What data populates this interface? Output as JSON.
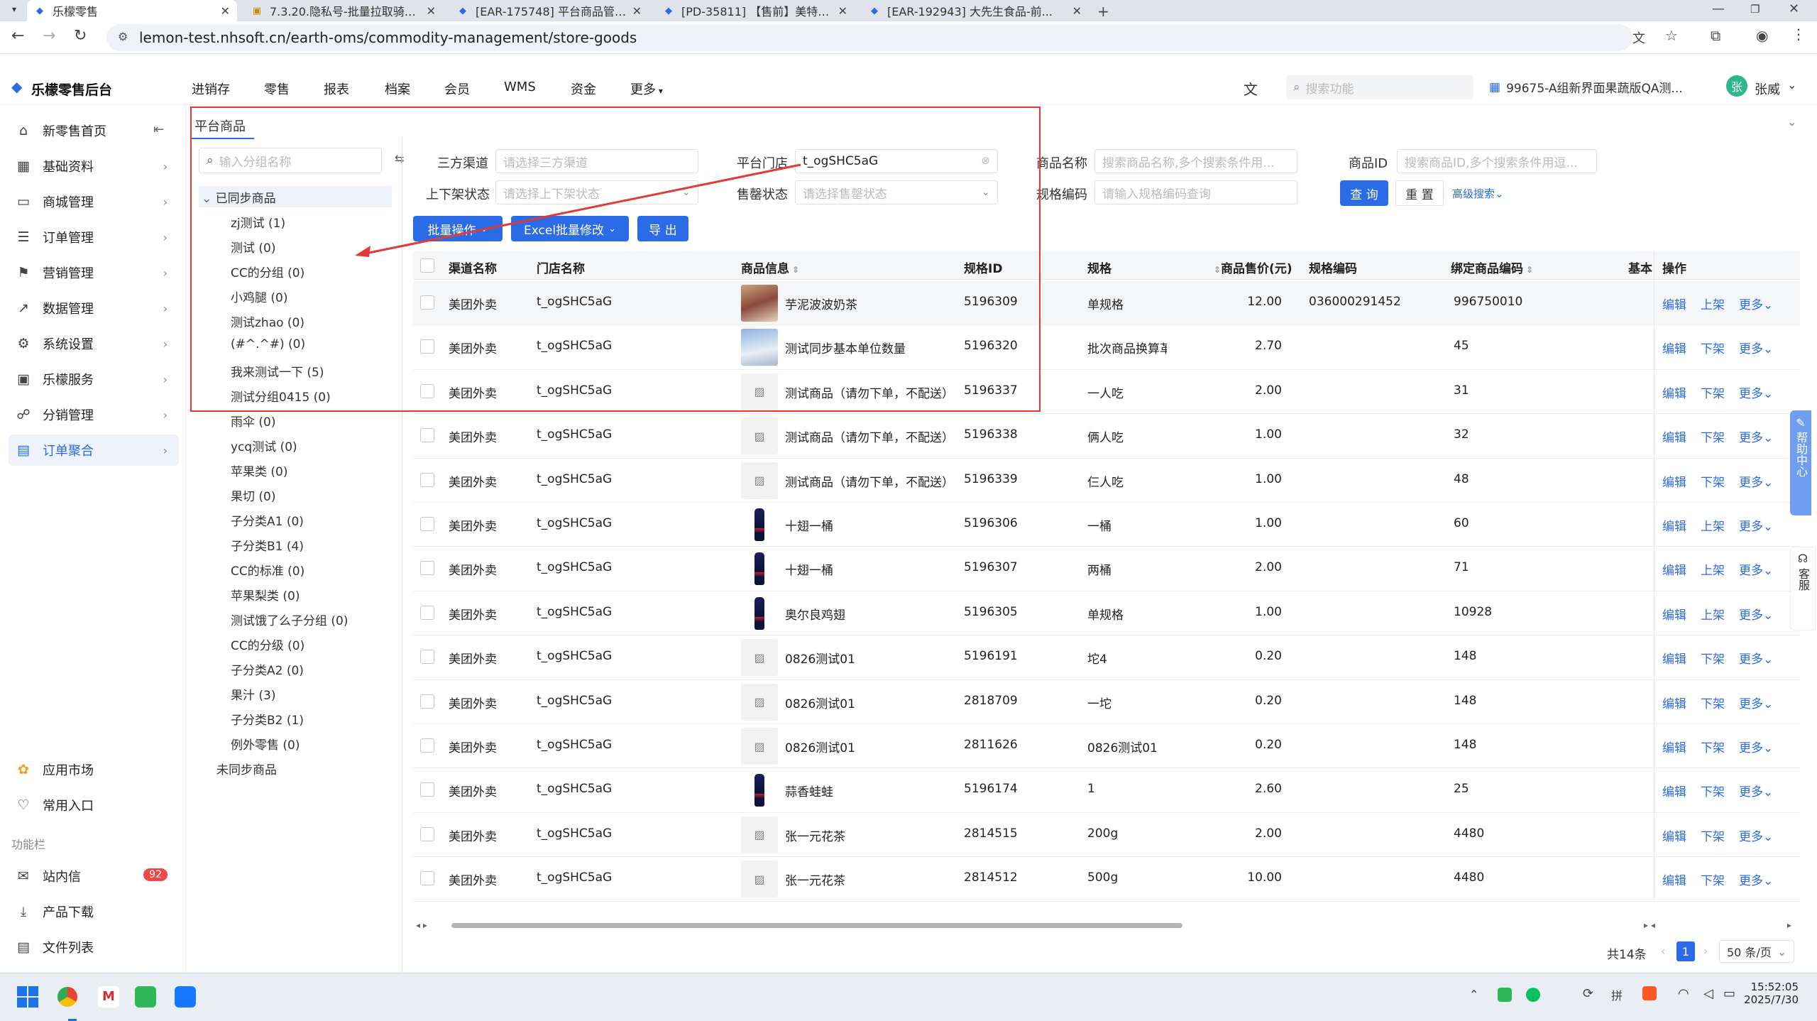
{
  "browser": {
    "tabs": [
      {
        "title": "乐檬零售",
        "active": true
      },
      {
        "title": "7.3.20.隐私号-批量拉取骑手手..."
      },
      {
        "title": "[EAR-175748] 平台商品管理页..."
      },
      {
        "title": "[PD-35811] 【售前】美特好超..."
      },
      {
        "title": "[EAR-192943] 大先生食品-前..."
      }
    ],
    "url": "lemon-test.nhsoft.cn/earth-oms/commodity-management/store-goods"
  },
  "header": {
    "brand": "乐檬零售后台",
    "nav": [
      "进销存",
      "零售",
      "报表",
      "档案",
      "会员",
      "WMS",
      "资金",
      "更多"
    ],
    "search_placeholder": "搜索功能",
    "store": "99675-A组新界面果蔬版QA测...",
    "user_avatar": "张",
    "user_name": "张威"
  },
  "sidebar": {
    "items": [
      {
        "label": "新零售首页",
        "icon": "home-icon"
      },
      {
        "label": "基础资料",
        "icon": "grid-icon"
      },
      {
        "label": "商城管理",
        "icon": "store-icon"
      },
      {
        "label": "订单管理",
        "icon": "order-icon"
      },
      {
        "label": "营销管理",
        "icon": "marketing-icon"
      },
      {
        "label": "数据管理",
        "icon": "chart-icon"
      },
      {
        "label": "系统设置",
        "icon": "settings-icon"
      },
      {
        "label": "乐檬服务",
        "icon": "service-icon"
      },
      {
        "label": "分销管理",
        "icon": "distribution-icon"
      },
      {
        "label": "订单聚合",
        "icon": "aggregate-icon",
        "active": true
      }
    ],
    "bottom": [
      {
        "label": "应用市场",
        "icon": "app-market-icon"
      },
      {
        "label": "常用入口",
        "icon": "heart-icon"
      }
    ],
    "section_label": "功能栏",
    "footer": [
      {
        "label": "站内信",
        "icon": "mail-icon",
        "badge": "92"
      },
      {
        "label": "产品下载",
        "icon": "download-icon"
      },
      {
        "label": "文件列表",
        "icon": "file-list-icon"
      }
    ]
  },
  "page": {
    "tab_title": "平台商品",
    "group_search_placeholder": "输入分组名称",
    "tree": {
      "root_synced": "已同步商品",
      "groups": [
        "zj测试 (1)",
        "测试 (0)",
        "CC的分组 (0)",
        "小鸡腿 (0)",
        "测试zhao (0)",
        "(#^.^#) (0)",
        "我来测试一下 (5)",
        "测试分组0415 (0)",
        "雨伞 (0)",
        "ycq测试 (0)",
        "苹果类 (0)",
        "果切 (0)",
        "子分类A1 (0)",
        "子分类B1 (4)",
        "CC的标准 (0)",
        "苹果梨类 (0)",
        "测试饿了么子分组 (0)",
        "CC的分级 (0)",
        "子分类A2 (0)",
        "果汁 (3)",
        "子分类B2 (1)",
        "例外零售 (0)"
      ],
      "root_unsynced": "未同步商品"
    },
    "filters": {
      "channel_label": "三方渠道",
      "channel_placeholder": "请选择三方渠道",
      "store_label": "平台门店",
      "store_value": "t_ogSHC5aG",
      "name_label": "商品名称",
      "name_placeholder": "搜索商品名称,多个搜索条件用...",
      "id_label": "商品ID",
      "id_placeholder": "搜索商品ID,多个搜索条件用逗...",
      "shelf_label": "上下架状态",
      "shelf_placeholder": "请选择上下架状态",
      "soldout_label": "售罄状态",
      "soldout_placeholder": "请选择售罄状态",
      "spec_label": "规格编码",
      "spec_placeholder": "请输入规格编码查询",
      "query_btn": "查 询",
      "reset_btn": "重 置",
      "advanced": "高级搜索"
    },
    "actions": {
      "batch": "批量操作",
      "excel": "Excel批量修改",
      "export": "导 出"
    },
    "table": {
      "columns": [
        "渠道名称",
        "门店名称",
        "商品信息",
        "规格ID",
        "规格",
        "商品售价(元)",
        "规格编码",
        "绑定商品编码",
        "基本",
        "操作"
      ],
      "rows": [
        {
          "channel": "美团外卖",
          "store": "t_ogSHC5aG",
          "name": "芋泥波波奶茶",
          "thumb": "photo-drink",
          "spec_id": "5196309",
          "spec": "单规格",
          "price": "12.00",
          "spec_code": "036000291452",
          "bind_code": "996750010",
          "shelf": "上架"
        },
        {
          "channel": "美团外卖",
          "store": "t_ogSHC5aG",
          "name": "测试同步基本单位数量",
          "thumb": "photo-sky",
          "spec_id": "5196320",
          "spec": "批次商品换算革",
          "price": "2.70",
          "spec_code": "",
          "bind_code": "45",
          "shelf": "下架"
        },
        {
          "channel": "美团外卖",
          "store": "t_ogSHC5aG",
          "name": "测试商品（请勿下单，不配送）",
          "thumb": "placeholder",
          "spec_id": "5196337",
          "spec": "一人吃",
          "price": "2.00",
          "spec_code": "",
          "bind_code": "31",
          "shelf": "下架"
        },
        {
          "channel": "美团外卖",
          "store": "t_ogSHC5aG",
          "name": "测试商品（请勿下单，不配送）",
          "thumb": "placeholder",
          "spec_id": "5196338",
          "spec": "俩人吃",
          "price": "1.00",
          "spec_code": "",
          "bind_code": "32",
          "shelf": "下架"
        },
        {
          "channel": "美团外卖",
          "store": "t_ogSHC5aG",
          "name": "测试商品（请勿下单，不配送）",
          "thumb": "placeholder",
          "spec_id": "5196339",
          "spec": "仨人吃",
          "price": "1.00",
          "spec_code": "",
          "bind_code": "48",
          "shelf": "下架"
        },
        {
          "channel": "美团外卖",
          "store": "t_ogSHC5aG",
          "name": "十翅一桶",
          "thumb": "bottle",
          "spec_id": "5196306",
          "spec": "一桶",
          "price": "1.00",
          "spec_code": "",
          "bind_code": "60",
          "shelf": "上架"
        },
        {
          "channel": "美团外卖",
          "store": "t_ogSHC5aG",
          "name": "十翅一桶",
          "thumb": "bottle",
          "spec_id": "5196307",
          "spec": "两桶",
          "price": "2.00",
          "spec_code": "",
          "bind_code": "71",
          "shelf": "上架"
        },
        {
          "channel": "美团外卖",
          "store": "t_ogSHC5aG",
          "name": "奥尔良鸡翅",
          "thumb": "bottle",
          "spec_id": "5196305",
          "spec": "单规格",
          "price": "1.00",
          "spec_code": "",
          "bind_code": "10928",
          "shelf": "上架"
        },
        {
          "channel": "美团外卖",
          "store": "t_ogSHC5aG",
          "name": "0826测试01",
          "thumb": "placeholder",
          "spec_id": "5196191",
          "spec": "坨4",
          "price": "0.20",
          "spec_code": "",
          "bind_code": "148",
          "shelf": "下架"
        },
        {
          "channel": "美团外卖",
          "store": "t_ogSHC5aG",
          "name": "0826测试01",
          "thumb": "placeholder",
          "spec_id": "2818709",
          "spec": "一坨",
          "price": "0.20",
          "spec_code": "",
          "bind_code": "148",
          "shelf": "下架"
        },
        {
          "channel": "美团外卖",
          "store": "t_ogSHC5aG",
          "name": "0826测试01",
          "thumb": "placeholder",
          "spec_id": "2811626",
          "spec": "0826测试01",
          "price": "0.20",
          "spec_code": "",
          "bind_code": "148",
          "shelf": "下架"
        },
        {
          "channel": "美团外卖",
          "store": "t_ogSHC5aG",
          "name": "蒜香蛙蛙",
          "thumb": "bottle",
          "spec_id": "5196174",
          "spec": "1",
          "price": "2.60",
          "spec_code": "",
          "bind_code": "25",
          "shelf": "下架"
        },
        {
          "channel": "美团外卖",
          "store": "t_ogSHC5aG",
          "name": "张一元花茶",
          "thumb": "placeholder",
          "spec_id": "2814515",
          "spec": "200g",
          "price": "2.00",
          "spec_code": "",
          "bind_code": "4480",
          "shelf": "下架"
        },
        {
          "channel": "美团外卖",
          "store": "t_ogSHC5aG",
          "name": "张一元花茶",
          "thumb": "placeholder",
          "spec_id": "2814512",
          "spec": "500g",
          "price": "10.00",
          "spec_code": "",
          "bind_code": "4480",
          "shelf": "下架"
        }
      ],
      "edit_label": "编辑",
      "more_label": "更多"
    },
    "pagination": {
      "total": "共14条",
      "current": "1",
      "page_size": "50 条/页"
    },
    "side_float": {
      "help": "帮助中心",
      "service": "客服"
    }
  },
  "taskbar": {
    "time": "15:52:05",
    "date": "2025/7/30"
  },
  "colors": {
    "accent": "#2b6be6",
    "annotation": "#e53935",
    "badge": "#f04848"
  }
}
